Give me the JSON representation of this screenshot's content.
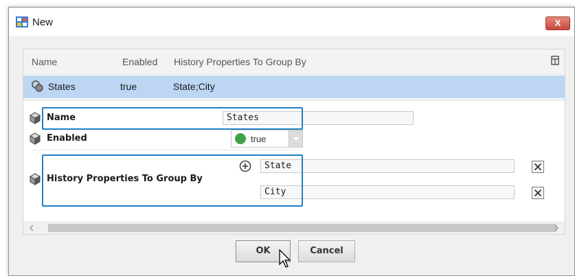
{
  "window": {
    "title": "New",
    "close_label": "X"
  },
  "table": {
    "headers": [
      "Name",
      "Enabled",
      "History Properties To Group By"
    ],
    "row": {
      "name": "States",
      "enabled": "true",
      "group_by": "State;City"
    }
  },
  "properties": {
    "name_label": "Name",
    "name_value": "States",
    "enabled_label": "Enabled",
    "enabled_value": "true",
    "group_label": "History Properties To Group By",
    "group_values": [
      "State",
      "City"
    ]
  },
  "buttons": {
    "ok_label": "OK",
    "cancel_label": "Cancel"
  },
  "colors": {
    "selection": "#bcd6f4",
    "highlight": "#1f7ec1",
    "enabled_dot": "#3fa24a",
    "close_button": "#c74a3b"
  },
  "icons": {
    "title": "app-icon",
    "row": "history-group-icon",
    "property": "component-cube-icon",
    "add": "add-circle-icon",
    "remove": "remove-x-icon",
    "cursor": "pointer-cursor-icon"
  }
}
